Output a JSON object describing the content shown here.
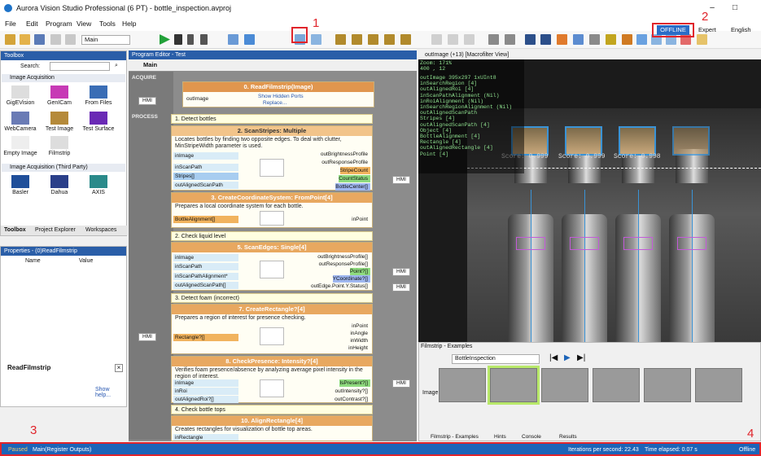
{
  "window": {
    "title": "Aurora Vision Studio Professional (6 PT) - bottle_inspection.avproj",
    "min": "–",
    "max": "□"
  },
  "menu": [
    "File",
    "Edit",
    "Program",
    "View",
    "Tools",
    "Help"
  ],
  "toolbar": {
    "program_select": "Main",
    "offline_label": "OFFLINE",
    "expert_label": "Expert",
    "language_label": "English"
  },
  "annotations": [
    "1",
    "2",
    "3",
    "4"
  ],
  "toolbox": {
    "title": "Toolbox",
    "search_label": "Search:",
    "section1": "Image Acquisition",
    "tools1": [
      "GigEVision",
      "GenICam",
      "From Files",
      "WebCamera",
      "Test Image",
      "Test Surface",
      "Empty Image",
      "Filmstrip"
    ],
    "section2": "Image Acquisition (Third Party)",
    "tools2": [
      "Basler",
      "Dahua",
      "AXIS"
    ],
    "tabs": [
      "Toolbox",
      "Project Explorer",
      "Workspaces"
    ]
  },
  "properties": {
    "title": "Properties - (0)ReadFilmstrip",
    "col_name": "Name",
    "col_value": "Value"
  },
  "readfilmstrip_label": "ReadFilmstrip",
  "show_help": "Show help...",
  "editor": {
    "title": "Program Editor - Test",
    "tab": "Main",
    "acquire": "ACQUIRE",
    "process": "PROCESS",
    "hmi": "HMI",
    "readfil": {
      "title": "0. ReadFilmstrip(Image)",
      "port": "outImage",
      "link1": "Show Hidden Ports",
      "link2": "Replace..."
    },
    "comments": [
      "1. Detect bottles",
      "2. Check liquid level",
      "3. Detect foam (incorrect)",
      "4. Check bottle tops"
    ],
    "scanstripes": {
      "title": "2. ScanStripes: Multiple",
      "desc": "Locates bottles by finding two opposite edges. To deal with clutter, MinStripeWidth parameter is used.",
      "ins": [
        "inImage",
        "inScanPath",
        "Stripes[]",
        "outAlignedScanPath"
      ],
      "outs": [
        "outBrightnessProfile",
        "outResponseProfile",
        "StripeCount",
        "CountStatus",
        "BottleCenter[]"
      ]
    },
    "coord": {
      "title": "3. CreateCoordinateSystem: FromPoint[4]",
      "desc": "Prepares a local coordinate system for each bottle.",
      "in": "BottleAlignment[]",
      "out": "inPoint"
    },
    "scanedges": {
      "title": "5. ScanEdges: Single[4]",
      "ins": [
        "inImage",
        "inScanPath",
        "inScanPathAlignment*",
        "outAlignedScanPath[]"
      ],
      "outs": [
        "outBrightnessProfile[]",
        "outResponseProfile[]",
        "Point?[]",
        "YCoordinate?[]",
        "outEdge.Point.Y.Status[]"
      ]
    },
    "rect": {
      "title": "7. CreateRectangle?[4]",
      "desc": "Prepares a region of interest for presence checking.",
      "in": "Rectangle?[]",
      "outs": [
        "inPoint",
        "inAngle",
        "inWidth",
        "inHeight"
      ]
    },
    "presence": {
      "title": "8. CheckPresence: Intensity?[4]",
      "desc": "Verifies foam presence/absence by analyzing average pixel intensity in the region of interest.",
      "ins": [
        "inImage",
        "inRoi",
        "outAlignedRoi?[]"
      ],
      "outs": [
        "IsPresent?[]",
        "outIntensity?[]",
        "outContrast?[]"
      ]
    },
    "align": {
      "title": "10. AlignRectangle[4]",
      "desc": "Creates rectangles for visualization of bottle top areas.",
      "in": "inRectangle"
    }
  },
  "view": {
    "title": "outImage (+13) [Macrofilter View]",
    "zoom": "Zoom: 171%",
    "coords": "400 , 12",
    "overlay": [
      "outImage 395x297 1xUInt8",
      "inSearchRegion [4]",
      "outAlignedRoi [4]",
      "inScanPathAlignment (Nil)",
      "inRoiAlignment (Nil)",
      "inSearchRegionAlignment (Nil)",
      "outAlignedScanPath",
      "Stripes [4]",
      "outAlignedScanPath [4]",
      "Object [4]",
      "BottleAlignment [4]",
      "Rectangle [4]",
      "outAlignedRectangle [4]",
      "Point [4]"
    ],
    "scores": [
      "Score: 0.999",
      "Score: 0.999",
      "Score: 0.998"
    ]
  },
  "filmstrip": {
    "title": "Filmstrip - Examples",
    "channel": "BottleInspection",
    "row_label": "Image",
    "tabs": [
      "Filmstrip - Examples",
      "Hints",
      "Console",
      "Results"
    ]
  },
  "status": {
    "state": "Paused",
    "context": "Main(Register Outputs)",
    "ips": "Iterations per second: 22.43",
    "elapsed": "Time elapsed: 0.07 s",
    "mode": "Offline"
  },
  "colors": {
    "accent": "#1c64b8",
    "red": "#e0242b",
    "orange": "#e8a860",
    "green": "#8fdb7f"
  }
}
